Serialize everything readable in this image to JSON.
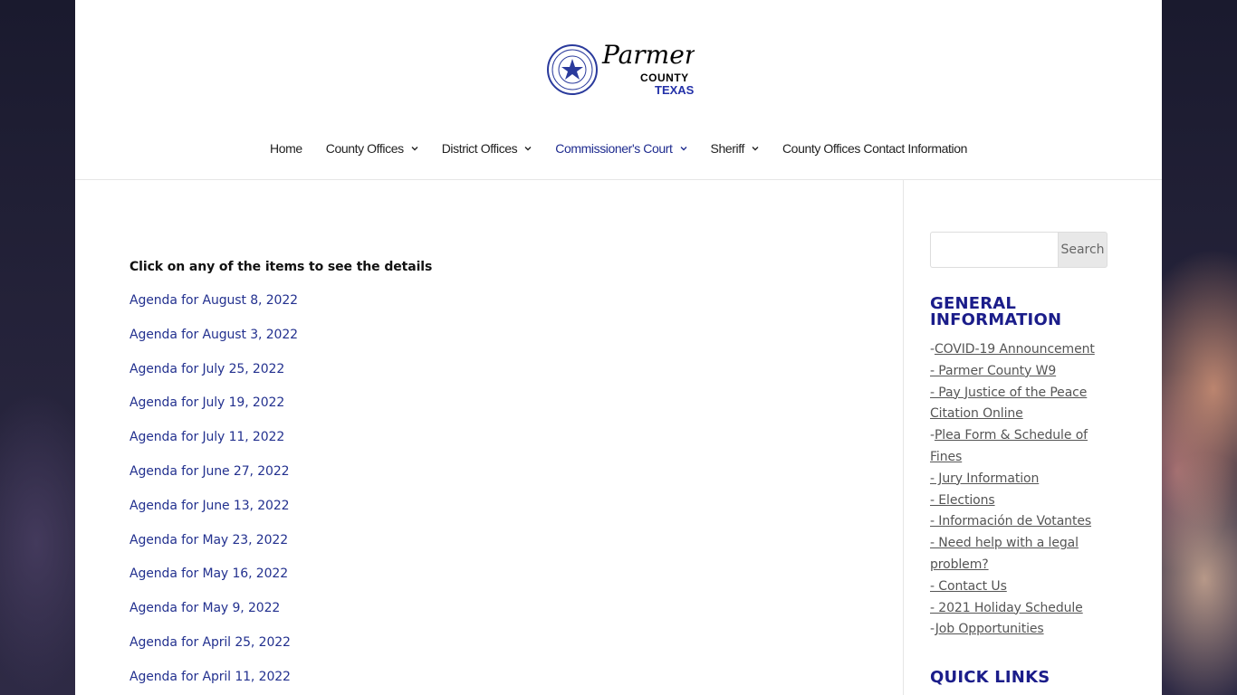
{
  "logo": {
    "seal_text": "THE STATE OF TEXAS PARMER COUNTY",
    "title": "Parmer",
    "county": "COUNTY",
    "state": "TEXAS"
  },
  "nav": {
    "items": [
      {
        "label": "Home",
        "has_dropdown": false,
        "active": false
      },
      {
        "label": "County Offices",
        "has_dropdown": true,
        "active": false
      },
      {
        "label": "District Offices",
        "has_dropdown": true,
        "active": false
      },
      {
        "label": "Commissioner's Court",
        "has_dropdown": true,
        "active": true
      },
      {
        "label": "Sheriff",
        "has_dropdown": true,
        "active": false
      },
      {
        "label": "County Offices Contact Information",
        "has_dropdown": false,
        "active": false
      }
    ]
  },
  "main": {
    "intro": "Click on any of the items to see the details",
    "agendas": [
      "Agenda for August 8, 2022",
      "Agenda for August 3, 2022",
      "Agenda for July 25, 2022",
      "Agenda for July 19, 2022",
      "Agenda for July 11, 2022",
      "Agenda for June 27, 2022",
      "Agenda for June 13, 2022",
      "Agenda for May 23, 2022",
      "Agenda for May 16, 2022",
      "Agenda for May 9, 2022",
      "Agenda for April 25, 2022",
      "Agenda for April 11, 2022"
    ]
  },
  "sidebar": {
    "search": {
      "placeholder": "",
      "button_label": "Search"
    },
    "general": {
      "title_line1": "GENERAL",
      "title_line2": "INFORMATION",
      "items": [
        {
          "prefix": "-",
          "label": "COVID-19 Announcement"
        },
        {
          "prefix": "",
          "label": "- Parmer County W9"
        },
        {
          "prefix": "",
          "label": "- Pay Justice of the Peace Citation Online"
        },
        {
          "prefix": "-",
          "label": "Plea Form & Schedule of Fines"
        },
        {
          "prefix": "",
          "label": "- Jury Information"
        },
        {
          "prefix": "",
          "label": "- Elections"
        },
        {
          "prefix": "",
          "label": "- Información de Votantes"
        },
        {
          "prefix": "",
          "label": "- Need help with a legal problem?"
        },
        {
          "prefix": "",
          "label": "- Contact Us"
        },
        {
          "prefix": "",
          "label": "- 2021 Holiday Schedule"
        },
        {
          "prefix": "-",
          "label": "Job Opportunities"
        }
      ]
    },
    "quick_links": {
      "title": "QUICK LINKS"
    }
  },
  "colors": {
    "nav_active": "#1f2c8f",
    "link": "#23318f",
    "heading": "#1b1d8a",
    "sidebar_link": "#555555"
  },
  "icons": {
    "dropdown": "chevron-down-icon",
    "seal": "texas-seal-icon"
  }
}
